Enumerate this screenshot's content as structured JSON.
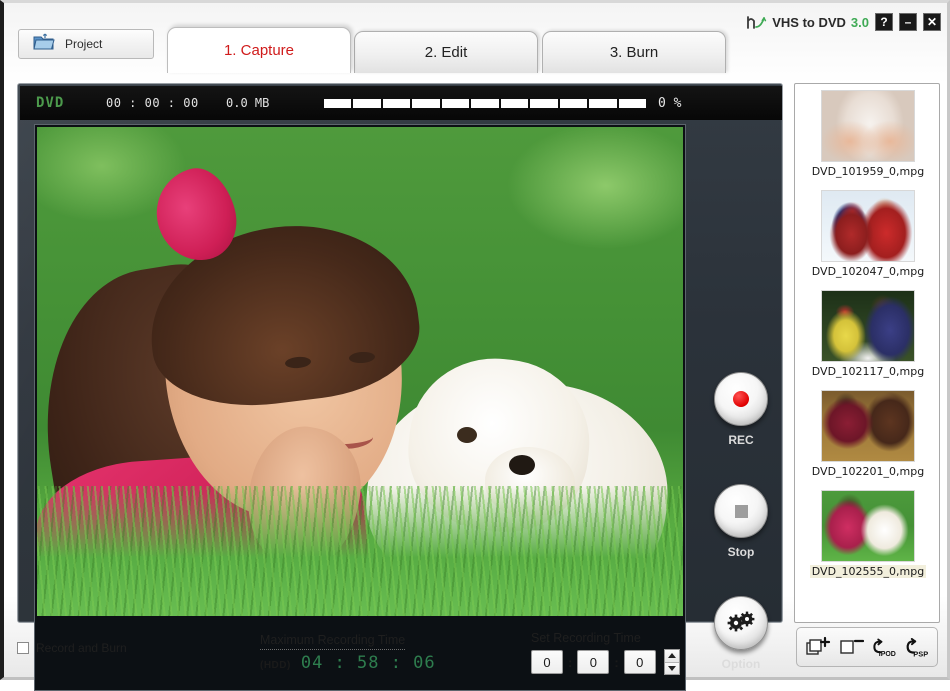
{
  "window": {
    "brand_name": "VHS to DVD",
    "brand_version": "3.0",
    "logo_icon": "h-arc-logo-icon",
    "help_button": "?",
    "minimize_button": "–",
    "close_button": "✕"
  },
  "toolbar": {
    "project_label": "Project",
    "project_icon": "folder-icon"
  },
  "tabs": [
    {
      "label": "1. Capture",
      "active": true
    },
    {
      "label": "2. Edit",
      "active": false
    },
    {
      "label": "3. Burn",
      "active": false
    }
  ],
  "status": {
    "format": "DVD",
    "timecode": "00 : 00 : 00",
    "size": "0.0 MB",
    "percent": "0 %",
    "progress_segments": 11,
    "progress_value": 0
  },
  "transport": [
    {
      "label": "REC",
      "icon": "record-dot-icon"
    },
    {
      "label": "Stop",
      "icon": "stop-square-icon"
    },
    {
      "label": "Option",
      "icon": "gears-icon"
    }
  ],
  "bottom": {
    "record_and_burn_label": "Record and Burn",
    "record_and_burn_checked": false,
    "max_recording_title": "Maximum Recording Time",
    "max_recording_source": "(HDD)",
    "max_recording_value": "04 : 58 : 06",
    "set_recording_title": "Set Recording Time",
    "set_recording_hours": "0",
    "set_recording_minutes": "0",
    "set_recording_seconds": "0",
    "colon": ":"
  },
  "thumbnails": [
    {
      "name": "DVD_101959_0,mpg",
      "selected": false
    },
    {
      "name": "DVD_102047_0,mpg",
      "selected": false
    },
    {
      "name": "DVD_102117_0,mpg",
      "selected": false
    },
    {
      "name": "DVD_102201_0,mpg",
      "selected": false
    },
    {
      "name": "DVD_102555_0,mpg",
      "selected": true
    }
  ],
  "thumb_toolbar": [
    {
      "icon": "add-file-icon",
      "label": ""
    },
    {
      "icon": "remove-file-icon",
      "label": ""
    },
    {
      "icon": "convert-ipod-icon",
      "label": "IPOD"
    },
    {
      "icon": "convert-psp-icon",
      "label": "PSP"
    }
  ],
  "colors": {
    "accent_red": "#d01b1b",
    "brand_green": "#3faa55",
    "timer_green": "#2e7d4e",
    "status_green": "#4c9a4c",
    "panel_dark": "#2b323a",
    "record_red": "#e00000"
  }
}
